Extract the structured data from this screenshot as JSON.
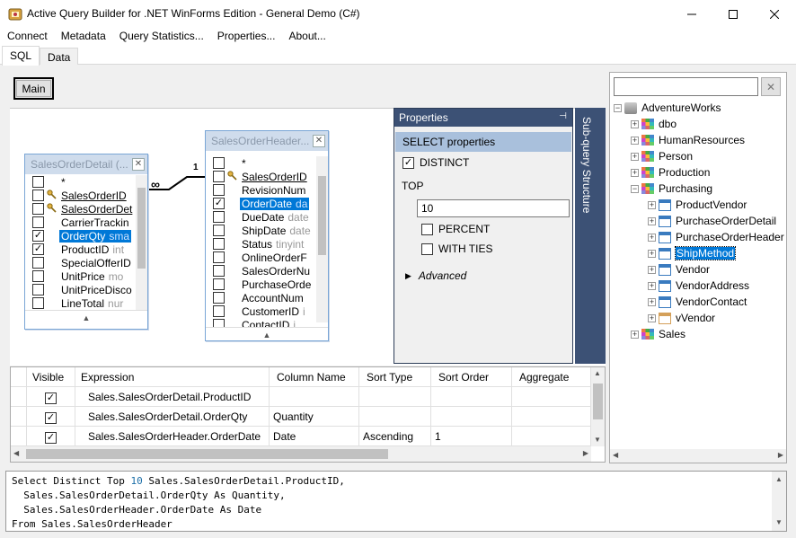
{
  "window": {
    "title": "Active Query Builder for .NET WinForms Edition - General Demo (C#)"
  },
  "menu": [
    "Connect",
    "Metadata",
    "Query Statistics...",
    "Properties...",
    "About..."
  ],
  "tabs": [
    "SQL",
    "Data"
  ],
  "active_tab": "SQL",
  "canvas": {
    "main_label": "Main"
  },
  "table1": {
    "title": "SalesOrderDetail (...",
    "fields": [
      {
        "name": "*",
        "type": "",
        "checked": false,
        "key": false,
        "underline": false,
        "selected": false
      },
      {
        "name": "SalesOrderID",
        "type": "",
        "checked": false,
        "key": true,
        "underline": true,
        "selected": false
      },
      {
        "name": "SalesOrderDet",
        "type": "",
        "checked": false,
        "key": true,
        "underline": true,
        "selected": false
      },
      {
        "name": "CarrierTrackin",
        "type": "",
        "checked": false,
        "key": false,
        "underline": false,
        "selected": false
      },
      {
        "name": "OrderQty",
        "type": "sma",
        "checked": true,
        "key": false,
        "underline": false,
        "selected": true
      },
      {
        "name": "ProductID",
        "type": "int",
        "checked": true,
        "key": false,
        "underline": false,
        "selected": false
      },
      {
        "name": "SpecialOfferID",
        "type": "",
        "checked": false,
        "key": false,
        "underline": false,
        "selected": false
      },
      {
        "name": "UnitPrice",
        "type": "mo",
        "checked": false,
        "key": false,
        "underline": false,
        "selected": false
      },
      {
        "name": "UnitPriceDisco",
        "type": "",
        "checked": false,
        "key": false,
        "underline": false,
        "selected": false
      },
      {
        "name": "LineTotal",
        "type": "nur",
        "checked": false,
        "key": false,
        "underline": false,
        "selected": false
      }
    ]
  },
  "table2": {
    "title": "SalesOrderHeader...",
    "fields": [
      {
        "name": "*",
        "type": "",
        "checked": false,
        "key": false,
        "underline": false,
        "selected": false
      },
      {
        "name": "SalesOrderID",
        "type": "",
        "checked": false,
        "key": true,
        "underline": true,
        "selected": false
      },
      {
        "name": "RevisionNum",
        "type": "",
        "checked": false,
        "key": false,
        "underline": false,
        "selected": false
      },
      {
        "name": "OrderDate",
        "type": "da",
        "checked": true,
        "key": false,
        "underline": false,
        "selected": true
      },
      {
        "name": "DueDate",
        "type": "date",
        "checked": false,
        "key": false,
        "underline": false,
        "selected": false
      },
      {
        "name": "ShipDate",
        "type": "date",
        "checked": false,
        "key": false,
        "underline": false,
        "selected": false
      },
      {
        "name": "Status",
        "type": "tinyint",
        "checked": false,
        "key": false,
        "underline": false,
        "selected": false
      },
      {
        "name": "OnlineOrderF",
        "type": "",
        "checked": false,
        "key": false,
        "underline": false,
        "selected": false
      },
      {
        "name": "SalesOrderNu",
        "type": "",
        "checked": false,
        "key": false,
        "underline": false,
        "selected": false
      },
      {
        "name": "PurchaseOrde",
        "type": "",
        "checked": false,
        "key": false,
        "underline": false,
        "selected": false
      },
      {
        "name": "AccountNum",
        "type": "",
        "checked": false,
        "key": false,
        "underline": false,
        "selected": false
      },
      {
        "name": "CustomerID",
        "type": "i",
        "checked": false,
        "key": false,
        "underline": false,
        "selected": false
      },
      {
        "name": "ContactID",
        "type": "i",
        "checked": false,
        "key": false,
        "underline": false,
        "selected": false
      }
    ]
  },
  "link": {
    "left_card": "∞",
    "right_card": "1"
  },
  "properties": {
    "title": "Properties",
    "pin": "⊣",
    "section": "SELECT properties",
    "distinct_label": "DISTINCT",
    "distinct_checked": true,
    "top_label": "TOP",
    "top_value": "10",
    "percent_label": "PERCENT",
    "withties_label": "WITH TIES",
    "advanced_label": "Advanced"
  },
  "subquery": {
    "label": "Sub-query Structure"
  },
  "grid": {
    "columns": [
      "Visible",
      "Expression",
      "Column Name",
      "Sort Type",
      "Sort Order",
      "Aggregate"
    ],
    "rows": [
      {
        "visible": true,
        "expression": "Sales.SalesOrderDetail.ProductID",
        "column_name": "",
        "sort_type": "",
        "sort_order": "",
        "aggregate": ""
      },
      {
        "visible": true,
        "expression": "Sales.SalesOrderDetail.OrderQty",
        "column_name": "Quantity",
        "sort_type": "",
        "sort_order": "",
        "aggregate": ""
      },
      {
        "visible": true,
        "expression": "Sales.SalesOrderHeader.OrderDate",
        "column_name": "Date",
        "sort_type": "Ascending",
        "sort_order": "1",
        "aggregate": ""
      }
    ]
  },
  "tree": {
    "search_value": "",
    "clear_label": "✕",
    "nodes": [
      {
        "label": "AdventureWorks",
        "icon": "database-icon",
        "level": 0,
        "exp": "−",
        "selected": false
      },
      {
        "label": "dbo",
        "icon": "schema-icon",
        "level": 1,
        "exp": "+",
        "selected": false
      },
      {
        "label": "HumanResources",
        "icon": "schema-icon",
        "level": 1,
        "exp": "+",
        "selected": false
      },
      {
        "label": "Person",
        "icon": "schema-icon",
        "level": 1,
        "exp": "+",
        "selected": false
      },
      {
        "label": "Production",
        "icon": "schema-icon",
        "level": 1,
        "exp": "+",
        "selected": false
      },
      {
        "label": "Purchasing",
        "icon": "schema-icon",
        "level": 1,
        "exp": "−",
        "selected": false
      },
      {
        "label": "ProductVendor",
        "icon": "table-icon",
        "level": 2,
        "exp": "+",
        "selected": false
      },
      {
        "label": "PurchaseOrderDetail",
        "icon": "table-icon",
        "level": 2,
        "exp": "+",
        "selected": false
      },
      {
        "label": "PurchaseOrderHeader",
        "icon": "table-icon",
        "level": 2,
        "exp": "+",
        "selected": false
      },
      {
        "label": "ShipMethod",
        "icon": "table-icon",
        "level": 2,
        "exp": "+",
        "selected": true
      },
      {
        "label": "Vendor",
        "icon": "table-icon",
        "level": 2,
        "exp": "+",
        "selected": false
      },
      {
        "label": "VendorAddress",
        "icon": "table-icon",
        "level": 2,
        "exp": "+",
        "selected": false
      },
      {
        "label": "VendorContact",
        "icon": "table-icon",
        "level": 2,
        "exp": "+",
        "selected": false
      },
      {
        "label": "vVendor",
        "icon": "view-icon",
        "level": 2,
        "exp": "+",
        "selected": false
      },
      {
        "label": "Sales",
        "icon": "schema-icon",
        "level": 1,
        "exp": "+",
        "selected": false
      }
    ]
  },
  "sql_lines": [
    [
      "Select Distinct Top ",
      "10",
      " Sales.SalesOrderDetail.ProductID,"
    ],
    [
      "  Sales.SalesOrderDetail.OrderQty As Quantity,",
      "",
      ""
    ],
    [
      "  Sales.SalesOrderHeader.OrderDate As Date",
      "",
      ""
    ],
    [
      "From Sales.SalesOrderHeader",
      "",
      ""
    ]
  ],
  "colors": {
    "accent": "#0078d7",
    "panel_dark": "#3c5175",
    "table_header": "#cfdcec"
  }
}
